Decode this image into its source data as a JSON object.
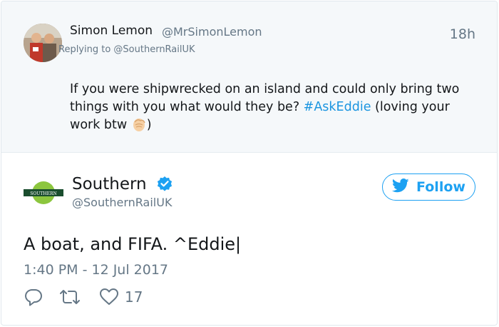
{
  "reply_tweet": {
    "name": "Simon Lemon",
    "handle": "@MrSimonLemon",
    "time": "18h",
    "replying_to": "Replying to @SouthernRailUK",
    "text_part1": "If you were shipwrecked on an island and could only bring two things with you what would they be? ",
    "hashtag": "#AskEddie",
    "text_part2": " (loving your work btw ",
    "text_part3": ")",
    "emoji_icon": "clapping-hands-icon"
  },
  "main_tweet": {
    "name": "Southern",
    "handle": "@SouthernRailUK",
    "logo_text": "SOUTHERN",
    "follow_label": "Follow",
    "text": "A boat, and FIFA. ^Eddie|",
    "timestamp": "1:40 PM - 12 Jul 2017",
    "likes": "17"
  },
  "colors": {
    "accent": "#1da1f2",
    "hashtag": "#1b95e0",
    "muted": "#657786",
    "text": "#14171a",
    "reply_bg": "#f5f8fa",
    "southern_green": "#8cc63e"
  },
  "icons": [
    "reply-icon",
    "retweet-icon",
    "heart-icon",
    "verified-icon",
    "twitter-bird-icon"
  ]
}
